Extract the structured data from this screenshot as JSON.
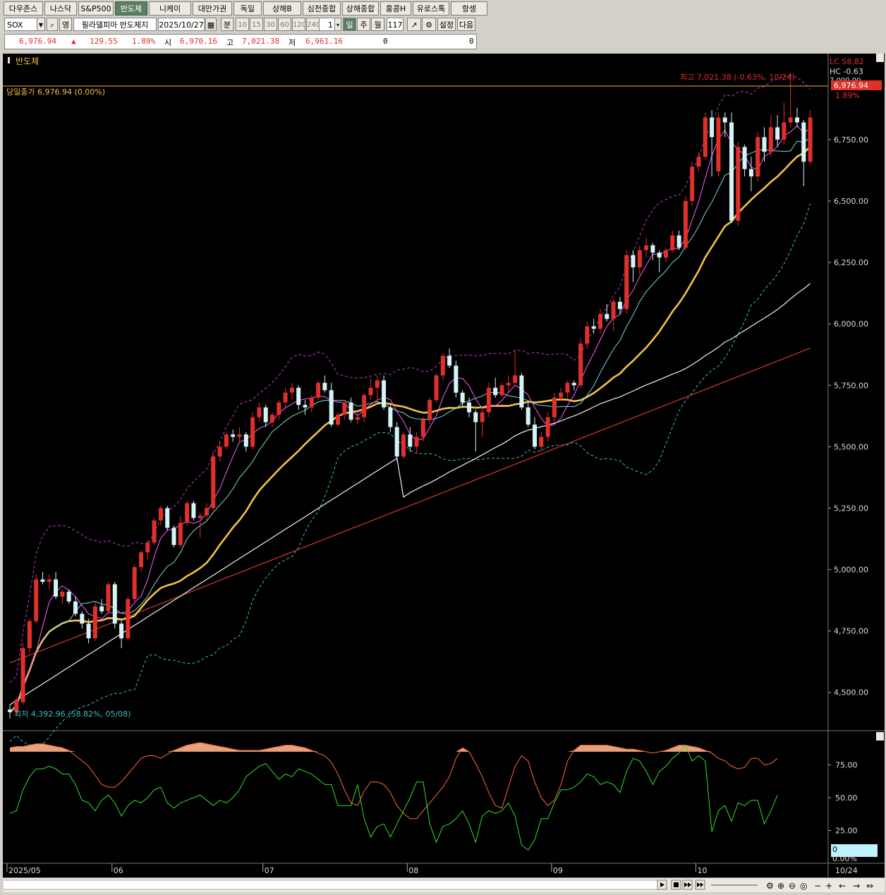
{
  "tabs": [
    "다우존스",
    "나스닥",
    "S&P500",
    "반도체",
    "니케이",
    "대만가권",
    "독일",
    "상해B",
    "심천종합",
    "상해종합",
    "홍콩H",
    "유로스톡",
    "항셍"
  ],
  "active_tab": 3,
  "toolbar": {
    "symbol": "SOX",
    "lang_button": "영",
    "index_name": "필라델피아 반도체지",
    "date": "2025/10/27",
    "minute_label": "분",
    "intervals": [
      "10",
      "15",
      "30",
      "60",
      "120",
      "240"
    ],
    "multiplier": "1",
    "periods": [
      "일",
      "주",
      "월"
    ],
    "active_period": "일",
    "count": "117",
    "settings_label": "설정",
    "next_label": "다음"
  },
  "quote": {
    "price": "6,976.94",
    "arrow": "▲",
    "change": "129.55",
    "change_pct": "1.89%",
    "open_label": "시",
    "open": "6,970.16",
    "high_label": "고",
    "high": "7,021.38",
    "low_label": "저",
    "low": "6,961.16",
    "volume1": "0",
    "volume2": "0"
  },
  "chart_labels": {
    "panel_title": "반도체",
    "close_label": "당일종가 6,976.94 (0.00%)",
    "high_note": "최고 7,021.38 (-0.63%, 10/24)",
    "low_note": "최저 4,392.96 (58.82%, 05/08)",
    "lc_label": "LC 58.82",
    "hc_label": "HC -0.63",
    "price_tag": "6,976.94",
    "pct_tag": "1.89%",
    "partial_tick": "7,000.00",
    "osc_value": "0",
    "osc_pct": "0.00%"
  },
  "colors": {
    "up": "#e0302a",
    "down": "#d4f4f8",
    "ma5": "#ff5cff",
    "ma10": "#7fd6d8",
    "ma20": "#f5c242",
    "ma60": "#f2f2f2",
    "ma120": "#d93a2a",
    "bb_upper": "#b040c0",
    "bb_lower": "#3bbdbd",
    "osc_orange": "#ff6a3a",
    "osc_green": "#2fe02f"
  },
  "chart_data": {
    "type": "candlestick",
    "ylim": [
      4350,
      7100
    ],
    "y_ticks": [
      4500,
      4750,
      5000,
      5250,
      5500,
      5750,
      6000,
      6250,
      6500,
      6750
    ],
    "y_tick_labels": [
      "4,500.00",
      "4,750.00",
      "5,000.00",
      "5,250.00",
      "5,500.00",
      "5,750.00",
      "6,000.00",
      "6,250.00",
      "6,500.00",
      "6,750.00"
    ],
    "x_labels": [
      {
        "index": 0,
        "label": "2025/05"
      },
      {
        "index": 16,
        "label": "06"
      },
      {
        "index": 39,
        "label": "07"
      },
      {
        "index": 61,
        "label": "08"
      },
      {
        "index": 83,
        "label": "09"
      },
      {
        "index": 105,
        "label": "10"
      }
    ],
    "x_end_label": "10/24",
    "candles": [
      [
        4430,
        4450,
        4392.96,
        4420
      ],
      [
        4420,
        4480,
        4410,
        4470
      ],
      [
        4460,
        4700,
        4450,
        4680
      ],
      [
        4680,
        4800,
        4660,
        4790
      ],
      [
        4790,
        4980,
        4780,
        4960
      ],
      [
        4960,
        4990,
        4940,
        4950
      ],
      [
        4950,
        4980,
        4920,
        4960
      ],
      [
        4960,
        4990,
        4880,
        4890
      ],
      [
        4890,
        4920,
        4860,
        4910
      ],
      [
        4910,
        4920,
        4860,
        4870
      ],
      [
        4870,
        4890,
        4810,
        4820
      ],
      [
        4820,
        4830,
        4760,
        4780
      ],
      [
        4780,
        4800,
        4700,
        4720
      ],
      [
        4720,
        4870,
        4710,
        4850
      ],
      [
        4850,
        4880,
        4820,
        4830
      ],
      [
        4830,
        4950,
        4820,
        4940
      ],
      [
        4940,
        4950,
        4760,
        4780
      ],
      [
        4780,
        4800,
        4680,
        4720
      ],
      [
        4720,
        4890,
        4710,
        4880
      ],
      [
        4880,
        5020,
        4870,
        5010
      ],
      [
        5010,
        5080,
        4990,
        5070
      ],
      [
        5070,
        5120,
        5040,
        5110
      ],
      [
        5110,
        5210,
        5100,
        5200
      ],
      [
        5200,
        5260,
        5180,
        5250
      ],
      [
        5250,
        5260,
        5160,
        5170
      ],
      [
        5170,
        5180,
        5090,
        5100
      ],
      [
        5100,
        5220,
        5090,
        5190
      ],
      [
        5190,
        5280,
        5180,
        5270
      ],
      [
        5270,
        5280,
        5200,
        5210
      ],
      [
        5210,
        5230,
        5130,
        5220
      ],
      [
        5220,
        5270,
        5200,
        5250
      ],
      [
        5250,
        5480,
        5240,
        5460
      ],
      [
        5460,
        5520,
        5440,
        5500
      ],
      [
        5500,
        5560,
        5490,
        5550
      ],
      [
        5550,
        5570,
        5520,
        5540
      ],
      [
        5540,
        5580,
        5520,
        5550
      ],
      [
        5550,
        5560,
        5480,
        5500
      ],
      [
        5500,
        5640,
        5490,
        5620
      ],
      [
        5620,
        5680,
        5600,
        5660
      ],
      [
        5660,
        5670,
        5580,
        5600
      ],
      [
        5600,
        5640,
        5580,
        5630
      ],
      [
        5630,
        5690,
        5610,
        5680
      ],
      [
        5680,
        5740,
        5660,
        5720
      ],
      [
        5720,
        5760,
        5690,
        5740
      ],
      [
        5740,
        5750,
        5650,
        5670
      ],
      [
        5670,
        5690,
        5630,
        5660
      ],
      [
        5660,
        5710,
        5640,
        5700
      ],
      [
        5700,
        5770,
        5690,
        5760
      ],
      [
        5760,
        5790,
        5720,
        5730
      ],
      [
        5730,
        5760,
        5580,
        5590
      ],
      [
        5590,
        5640,
        5580,
        5630
      ],
      [
        5630,
        5690,
        5610,
        5680
      ],
      [
        5680,
        5700,
        5600,
        5610
      ],
      [
        5610,
        5640,
        5590,
        5620
      ],
      [
        5620,
        5720,
        5600,
        5710
      ],
      [
        5710,
        5780,
        5690,
        5740
      ],
      [
        5740,
        5790,
        5690,
        5770
      ],
      [
        5770,
        5790,
        5650,
        5660
      ],
      [
        5660,
        5670,
        5560,
        5580
      ],
      [
        5580,
        5600,
        5440,
        5460
      ],
      [
        5460,
        5560,
        5450,
        5550
      ],
      [
        5550,
        5580,
        5480,
        5500
      ],
      [
        5500,
        5560,
        5470,
        5540
      ],
      [
        5540,
        5620,
        5520,
        5610
      ],
      [
        5610,
        5700,
        5590,
        5690
      ],
      [
        5690,
        5800,
        5680,
        5790
      ],
      [
        5790,
        5880,
        5770,
        5870
      ],
      [
        5870,
        5900,
        5820,
        5830
      ],
      [
        5830,
        5850,
        5700,
        5720
      ],
      [
        5720,
        5730,
        5660,
        5680
      ],
      [
        5680,
        5700,
        5620,
        5640
      ],
      [
        5640,
        5650,
        5480,
        5600
      ],
      [
        5600,
        5660,
        5540,
        5640
      ],
      [
        5640,
        5760,
        5620,
        5740
      ],
      [
        5740,
        5780,
        5700,
        5710
      ],
      [
        5710,
        5760,
        5700,
        5750
      ],
      [
        5750,
        5790,
        5720,
        5760
      ],
      [
        5760,
        5890,
        5750,
        5790
      ],
      [
        5790,
        5800,
        5650,
        5660
      ],
      [
        5660,
        5680,
        5580,
        5590
      ],
      [
        5590,
        5620,
        5490,
        5500
      ],
      [
        5500,
        5560,
        5480,
        5540
      ],
      [
        5540,
        5640,
        5520,
        5620
      ],
      [
        5620,
        5720,
        5600,
        5700
      ],
      [
        5700,
        5740,
        5690,
        5720
      ],
      [
        5720,
        5770,
        5700,
        5760
      ],
      [
        5760,
        5770,
        5730,
        5750
      ],
      [
        5750,
        5940,
        5740,
        5920
      ],
      [
        5920,
        6010,
        5900,
        5990
      ],
      [
        5990,
        6020,
        5960,
        5980
      ],
      [
        5980,
        6060,
        5960,
        6040
      ],
      [
        6040,
        6080,
        6010,
        6020
      ],
      [
        6020,
        6100,
        5970,
        6090
      ],
      [
        6090,
        6110,
        6040,
        6060
      ],
      [
        6060,
        6300,
        6040,
        6280
      ],
      [
        6280,
        6300,
        6170,
        6230
      ],
      [
        6230,
        6320,
        6200,
        6300
      ],
      [
        6300,
        6350,
        6270,
        6320
      ],
      [
        6320,
        6330,
        6260,
        6290
      ],
      [
        6290,
        6300,
        6210,
        6270
      ],
      [
        6270,
        6310,
        6250,
        6300
      ],
      [
        6300,
        6380,
        6290,
        6360
      ],
      [
        6360,
        6380,
        6300,
        6310
      ],
      [
        6310,
        6520,
        6300,
        6500
      ],
      [
        6500,
        6660,
        6480,
        6640
      ],
      [
        6640,
        6700,
        6620,
        6680
      ],
      [
        6680,
        6860,
        6670,
        6840
      ],
      [
        6840,
        6870,
        6600,
        6760
      ],
      [
        6620,
        6860,
        6600,
        6840
      ],
      [
        6840,
        6860,
        6760,
        6820
      ],
      [
        6820,
        6860,
        6410,
        6420
      ],
      [
        6420,
        6740,
        6400,
        6720
      ],
      [
        6720,
        6730,
        6600,
        6630
      ],
      [
        6630,
        6680,
        6540,
        6600
      ],
      [
        6600,
        6780,
        6580,
        6760
      ],
      [
        6760,
        6800,
        6660,
        6700
      ],
      [
        6700,
        6850,
        6680,
        6800
      ],
      [
        6800,
        6850,
        6720,
        6750
      ],
      [
        6750,
        6900,
        6730,
        6820
      ],
      [
        6820,
        7021.38,
        6800,
        6840
      ],
      [
        6840,
        6880,
        6800,
        6820
      ],
      [
        6820,
        6830,
        6560,
        6660
      ],
      [
        6660,
        6870,
        6650,
        6840
      ]
    ],
    "ma_periods": [
      5,
      10,
      20,
      60,
      120
    ],
    "oscillator": {
      "ylim": [
        0,
        100
      ],
      "y_ticks": [
        25,
        50,
        75
      ],
      "y_tick_labels": [
        "25.00",
        "50.00",
        "75.00"
      ],
      "orange": [
        88,
        89,
        89,
        90,
        91,
        91,
        90,
        89,
        88,
        86,
        82,
        78,
        74,
        67,
        60,
        58,
        58,
        62,
        68,
        74,
        80,
        82,
        82,
        80,
        83,
        86,
        88,
        90,
        91,
        92,
        91,
        90,
        89,
        88,
        87,
        86,
        86,
        86,
        86,
        87,
        88,
        89,
        90,
        90,
        89,
        88,
        86,
        84,
        82,
        77,
        68,
        56,
        46,
        44,
        55,
        62,
        62,
        60,
        54,
        44,
        38,
        34,
        34,
        40,
        46,
        52,
        58,
        66,
        80,
        88,
        85,
        76,
        66,
        54,
        44,
        42,
        58,
        74,
        82,
        78,
        62,
        50,
        44,
        48,
        60,
        78,
        86,
        90,
        90,
        90,
        90,
        90,
        89,
        88,
        87,
        87,
        86,
        85,
        84,
        85,
        86,
        88,
        90,
        90,
        89,
        88,
        86,
        84,
        80,
        78,
        74,
        72,
        73,
        80,
        80,
        75,
        76,
        80
      ],
      "green": [
        38,
        40,
        56,
        66,
        72,
        72,
        74,
        72,
        68,
        68,
        60,
        48,
        46,
        40,
        48,
        52,
        46,
        36,
        44,
        48,
        46,
        50,
        56,
        58,
        46,
        42,
        46,
        48,
        50,
        52,
        48,
        44,
        48,
        46,
        50,
        56,
        66,
        70,
        74,
        76,
        70,
        64,
        68,
        66,
        72,
        70,
        68,
        64,
        60,
        60,
        44,
        44,
        44,
        60,
        34,
        20,
        28,
        30,
        20,
        30,
        40,
        50,
        62,
        62,
        30,
        16,
        28,
        30,
        34,
        40,
        30,
        16,
        36,
        40,
        38,
        40,
        46,
        36,
        14,
        10,
        18,
        34,
        34,
        46,
        56,
        56,
        58,
        62,
        68,
        66,
        60,
        62,
        60,
        54,
        70,
        80,
        78,
        70,
        60,
        70,
        74,
        80,
        84,
        90,
        78,
        82,
        78,
        24,
        40,
        44,
        32,
        46,
        44,
        48,
        48,
        30,
        40,
        52
      ]
    }
  }
}
